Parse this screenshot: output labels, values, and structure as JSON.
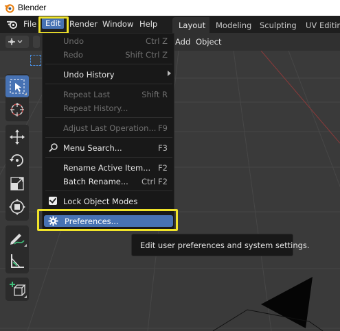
{
  "window": {
    "title": "Blender"
  },
  "menubar": {
    "items": [
      "File",
      "Edit",
      "Render",
      "Window",
      "Help"
    ],
    "active": "Edit"
  },
  "workspace_tabs": [
    "Layout",
    "Modeling",
    "Sculpting",
    "UV Editing"
  ],
  "workspace_active": "Layout",
  "viewport_header": {
    "add_label": "Add",
    "object_label": "Object"
  },
  "edit_menu": {
    "items": [
      {
        "label": "Undo",
        "shortcut": "Ctrl Z",
        "disabled": true
      },
      {
        "label": "Redo",
        "shortcut": "Shift Ctrl Z",
        "disabled": true
      },
      {
        "label": "Undo History",
        "shortcut": "",
        "submenu": true
      },
      {
        "label": "Repeat Last",
        "shortcut": "Shift R",
        "disabled": true
      },
      {
        "label": "Repeat History...",
        "shortcut": "",
        "disabled": true
      },
      {
        "label": "Adjust Last Operation...",
        "shortcut": "F9",
        "disabled": true
      },
      {
        "label": "Menu Search...",
        "shortcut": "F3",
        "icon": "search-icon"
      },
      {
        "label": "Rename Active Item...",
        "shortcut": "F2"
      },
      {
        "label": "Batch Rename...",
        "shortcut": "Ctrl F2"
      },
      {
        "label": "Lock Object Modes",
        "shortcut": "",
        "checked": true
      },
      {
        "label": "Preferences...",
        "shortcut": "",
        "icon": "gear-icon",
        "highlighted": true
      }
    ]
  },
  "tooltip": {
    "text": "Edit user preferences and system settings."
  },
  "colors": {
    "accent": "#4772b3",
    "highlight_box": "#f0e32a",
    "menu_bg": "#181818",
    "viewport_bg": "#3a3a3a"
  }
}
